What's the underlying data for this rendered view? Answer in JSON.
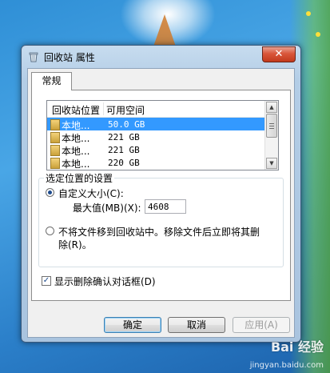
{
  "window": {
    "title": "回收站 属性",
    "close_glyph": "✕"
  },
  "tabs": [
    {
      "label": "常规"
    }
  ],
  "list": {
    "columns": [
      "回收站位置",
      "可用空间"
    ],
    "rows": [
      {
        "location": "本地...",
        "space": "50.0 GB",
        "selected": true
      },
      {
        "location": "本地...",
        "space": "221 GB",
        "selected": false
      },
      {
        "location": "本地...",
        "space": "221 GB",
        "selected": false
      },
      {
        "location": "本地...",
        "space": "220 GB",
        "selected": false
      }
    ]
  },
  "settings": {
    "group_title": "选定位置的设置",
    "custom_size_label": "自定义大小(C):",
    "max_label": "最大值(MB)(X):",
    "max_value": "4608",
    "no_move_label_line1": "不将文件移到回收站中。移除文件后立即将其删",
    "no_move_label_line2": "除(R)。",
    "custom_selected": true
  },
  "confirm": {
    "label": "显示删除确认对话框(D)",
    "checked": true
  },
  "buttons": {
    "ok": "确定",
    "cancel": "取消",
    "apply": "应用(A)"
  },
  "watermark": {
    "brand": "Bai  经验",
    "url": "jingyan.baidu.com"
  },
  "icons": {
    "close": "close-icon",
    "recycle_bin": "recycle-bin-icon",
    "drive": "drive-icon",
    "scroll_up": "scroll-up-arrow-icon",
    "scroll_down": "scroll-down-arrow-icon"
  }
}
